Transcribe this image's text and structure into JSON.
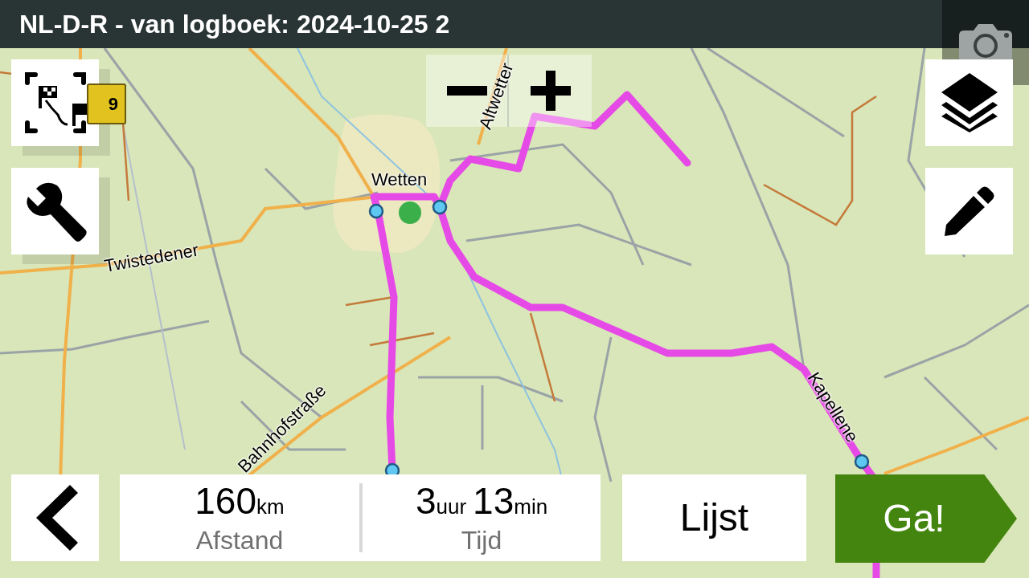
{
  "title": "NL-D-R - van logboek: 2024-10-25 2",
  "map": {
    "labels": [
      {
        "text": "Wetten",
        "kind": "place"
      },
      {
        "text": "Twistedener",
        "kind": "street"
      },
      {
        "text": "Altwetter",
        "kind": "street"
      },
      {
        "text": "Bahnhofstraße",
        "kind": "street"
      },
      {
        "text": "Kapellene",
        "kind": "street"
      },
      {
        "text": "9",
        "kind": "shield"
      }
    ]
  },
  "stats": [
    {
      "value": "160",
      "unit": "km",
      "label": "Afstand"
    },
    {
      "value": "3",
      "unit": "uur",
      "value_2": "13",
      "unit_2": "min",
      "label": "Tijd"
    }
  ],
  "buttons": {
    "list": "Lijst",
    "go": "Ga!"
  }
}
